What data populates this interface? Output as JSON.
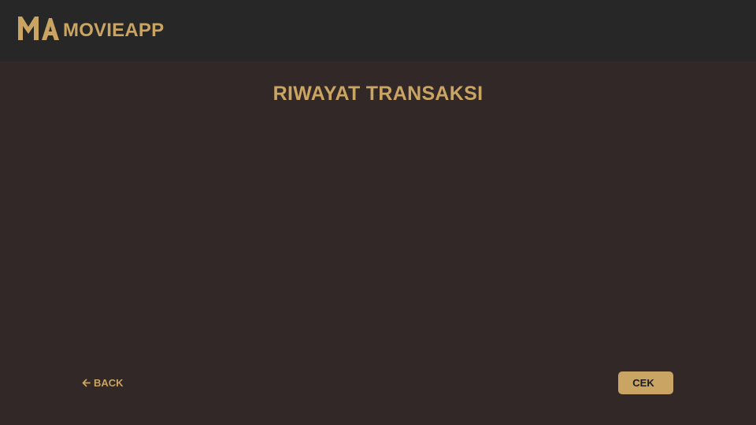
{
  "header": {
    "logo_icon": "ma-logo-icon",
    "brand": "MOVIEAPP"
  },
  "main": {
    "title": "RIWAYAT TRANSAKSI"
  },
  "footer": {
    "back_icon": "arrow-left-icon",
    "back_label": "BACK",
    "check_label": "CEK"
  },
  "colors": {
    "background": "#312827",
    "header_background": "#272727",
    "accent": "#c9a462",
    "button_text": "#1c1c1c"
  }
}
